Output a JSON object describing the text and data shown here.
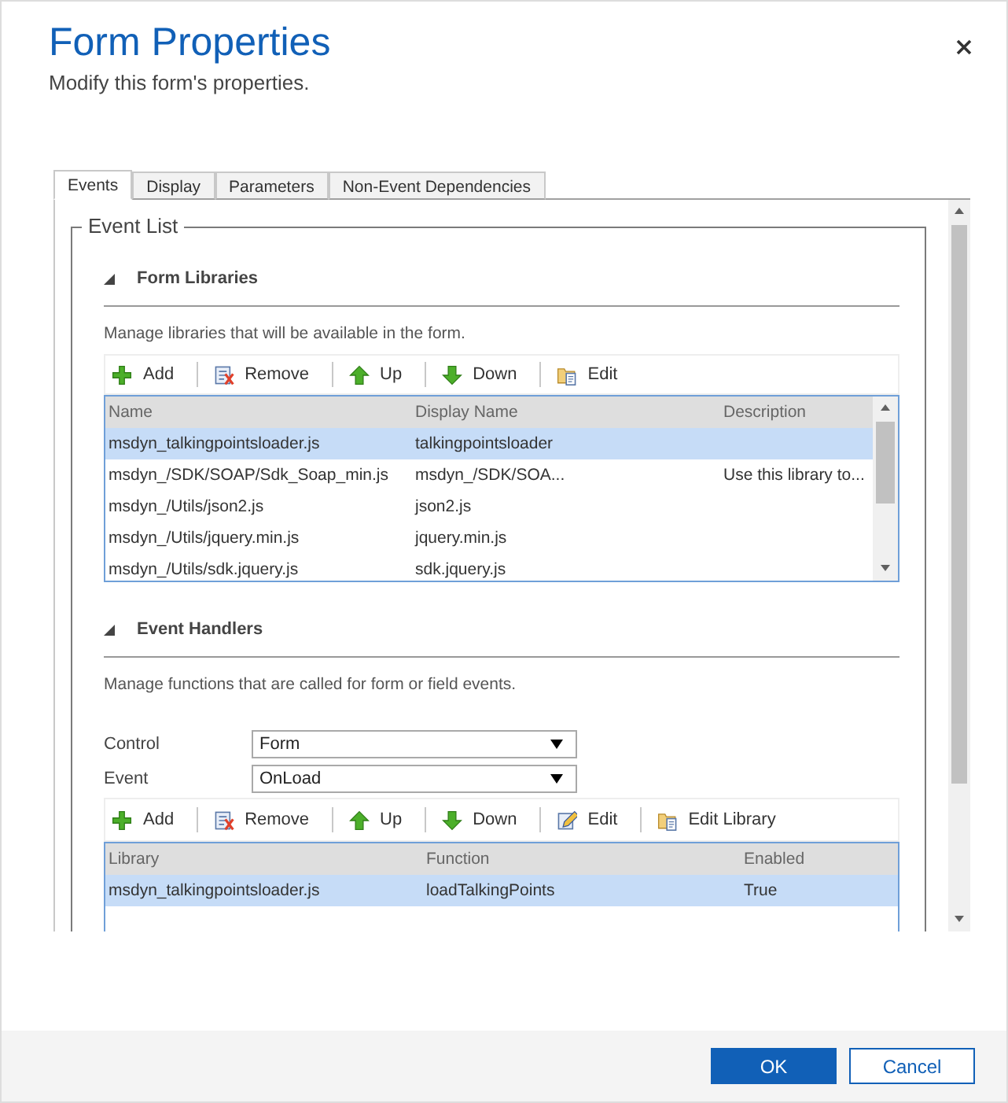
{
  "dialog": {
    "title": "Form Properties",
    "subtitle": "Modify this form's properties."
  },
  "tabs": [
    {
      "label": "Events",
      "selected": true
    },
    {
      "label": "Display",
      "selected": false
    },
    {
      "label": "Parameters",
      "selected": false
    },
    {
      "label": "Non-Event Dependencies",
      "selected": false
    }
  ],
  "event_list": {
    "legend": "Event List",
    "form_libraries": {
      "title": "Form Libraries",
      "expanded": true,
      "description": "Manage libraries that will be available in the form.",
      "toolbar": [
        {
          "kind": "add",
          "label": "Add"
        },
        {
          "kind": "remove",
          "label": "Remove"
        },
        {
          "kind": "up",
          "label": "Up"
        },
        {
          "kind": "down",
          "label": "Down"
        },
        {
          "kind": "edit_library",
          "label": "Edit"
        }
      ],
      "columns": [
        "Name",
        "Display Name",
        "Description"
      ],
      "rows": [
        {
          "cells": [
            "msdyn_talkingpointsloader.js",
            "talkingpointsloader",
            ""
          ],
          "selected": true
        },
        {
          "cells": [
            "msdyn_/SDK/SOAP/Sdk_Soap_min.js",
            "msdyn_/SDK/SOA...",
            "Use this library to..."
          ],
          "selected": false
        },
        {
          "cells": [
            "msdyn_/Utils/json2.js",
            "json2.js",
            ""
          ],
          "selected": false
        },
        {
          "cells": [
            "msdyn_/Utils/jquery.min.js",
            "jquery.min.js",
            ""
          ],
          "selected": false
        },
        {
          "cells": [
            "msdyn_/Utils/sdk.jquery.js",
            "sdk.jquery.js",
            ""
          ],
          "selected": false
        }
      ]
    },
    "event_handlers": {
      "title": "Event Handlers",
      "expanded": true,
      "description": "Manage functions that are called for form or field events.",
      "fields": [
        {
          "label": "Control",
          "value": "Form"
        },
        {
          "label": "Event",
          "value": "OnLoad"
        }
      ],
      "toolbar": [
        {
          "kind": "add",
          "label": "Add"
        },
        {
          "kind": "remove",
          "label": "Remove"
        },
        {
          "kind": "up",
          "label": "Up"
        },
        {
          "kind": "down",
          "label": "Down"
        },
        {
          "kind": "edit",
          "label": "Edit"
        },
        {
          "kind": "edit_library",
          "label": "Edit Library"
        }
      ],
      "columns": [
        "Library",
        "Function",
        "Enabled"
      ],
      "rows": [
        {
          "cells": [
            "msdyn_talkingpointsloader.js",
            "loadTalkingPoints",
            "True"
          ],
          "selected": true
        }
      ]
    }
  },
  "buttons": [
    {
      "label": "OK",
      "kind": "primary"
    },
    {
      "label": "Cancel",
      "kind": "secondary"
    }
  ]
}
